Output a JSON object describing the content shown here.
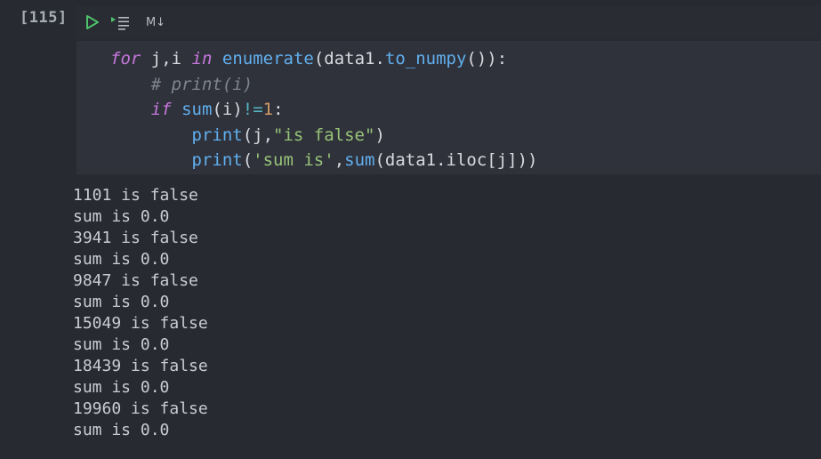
{
  "cell": {
    "execution_count": "[115]",
    "toolbar": {
      "run_icon": "run-triangle-icon",
      "run_below_icon": "run-below-icon",
      "markdown_label": "M↓"
    },
    "code_lines": [
      [
        {
          "text": "for",
          "cls": "kw"
        },
        {
          "text": " j,i ",
          "cls": ""
        },
        {
          "text": "in",
          "cls": "kw"
        },
        {
          "text": " ",
          "cls": ""
        },
        {
          "text": "enumerate",
          "cls": "fn"
        },
        {
          "text": "(data1.",
          "cls": ""
        },
        {
          "text": "to_numpy",
          "cls": "fn"
        },
        {
          "text": "()):",
          "cls": ""
        }
      ],
      [
        {
          "text": "    ",
          "cls": ""
        },
        {
          "text": "# print(i)",
          "cls": "cm"
        }
      ],
      [
        {
          "text": "    ",
          "cls": ""
        },
        {
          "text": "if",
          "cls": "kw"
        },
        {
          "text": " ",
          "cls": ""
        },
        {
          "text": "sum",
          "cls": "fn"
        },
        {
          "text": "(i)",
          "cls": ""
        },
        {
          "text": "!=",
          "cls": "op"
        },
        {
          "text": "1",
          "cls": "num"
        },
        {
          "text": ":",
          "cls": ""
        }
      ],
      [
        {
          "text": "        ",
          "cls": ""
        },
        {
          "text": "print",
          "cls": "fn"
        },
        {
          "text": "(j,",
          "cls": ""
        },
        {
          "text": "\"is false\"",
          "cls": "str"
        },
        {
          "text": ")",
          "cls": ""
        }
      ],
      [
        {
          "text": "        ",
          "cls": ""
        },
        {
          "text": "print",
          "cls": "fn"
        },
        {
          "text": "(",
          "cls": ""
        },
        {
          "text": "'sum is'",
          "cls": "str"
        },
        {
          "text": ",",
          "cls": ""
        },
        {
          "text": "sum",
          "cls": "fn"
        },
        {
          "text": "(data1.iloc[j]))",
          "cls": ""
        }
      ]
    ],
    "output_lines": [
      "1101 is false",
      "sum is 0.0",
      "3941 is false",
      "sum is 0.0",
      "9847 is false",
      "sum is 0.0",
      "15049 is false",
      "sum is 0.0",
      "18439 is false",
      "sum is 0.0",
      "19960 is false",
      "sum is 0.0"
    ]
  },
  "colors": {
    "background": "#272a31",
    "editor_background": "#2f323a",
    "keyword": "#c678dd",
    "function": "#61afef",
    "number": "#d19a66",
    "string": "#98c379",
    "comment": "#7f848e",
    "run_icon": "#4ec36b"
  }
}
